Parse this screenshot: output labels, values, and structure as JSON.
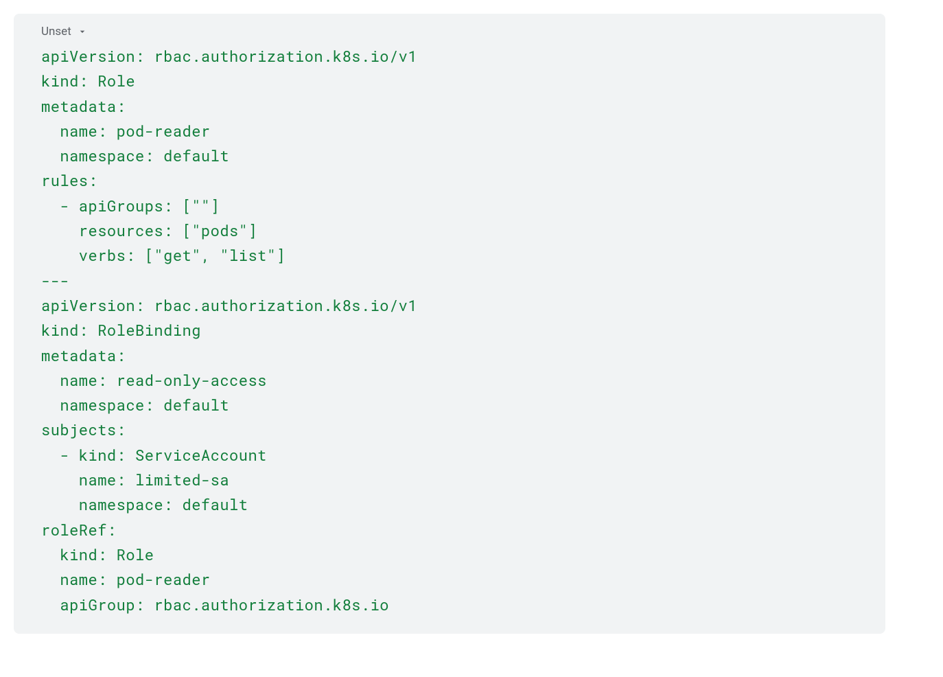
{
  "header": {
    "language_label": "Unset"
  },
  "code": {
    "lines": [
      "apiVersion: rbac.authorization.k8s.io/v1",
      "kind: Role",
      "metadata:",
      "  name: pod-reader",
      "  namespace: default",
      "rules:",
      "  - apiGroups: [\"\"]",
      "    resources: [\"pods\"]",
      "    verbs: [\"get\", \"list\"]",
      "---",
      "apiVersion: rbac.authorization.k8s.io/v1",
      "kind: RoleBinding",
      "metadata:",
      "  name: read-only-access",
      "  namespace: default",
      "subjects:",
      "  - kind: ServiceAccount",
      "    name: limited-sa",
      "    namespace: default",
      "roleRef:",
      "  kind: Role",
      "  name: pod-reader",
      "  apiGroup: rbac.authorization.k8s.io"
    ]
  }
}
